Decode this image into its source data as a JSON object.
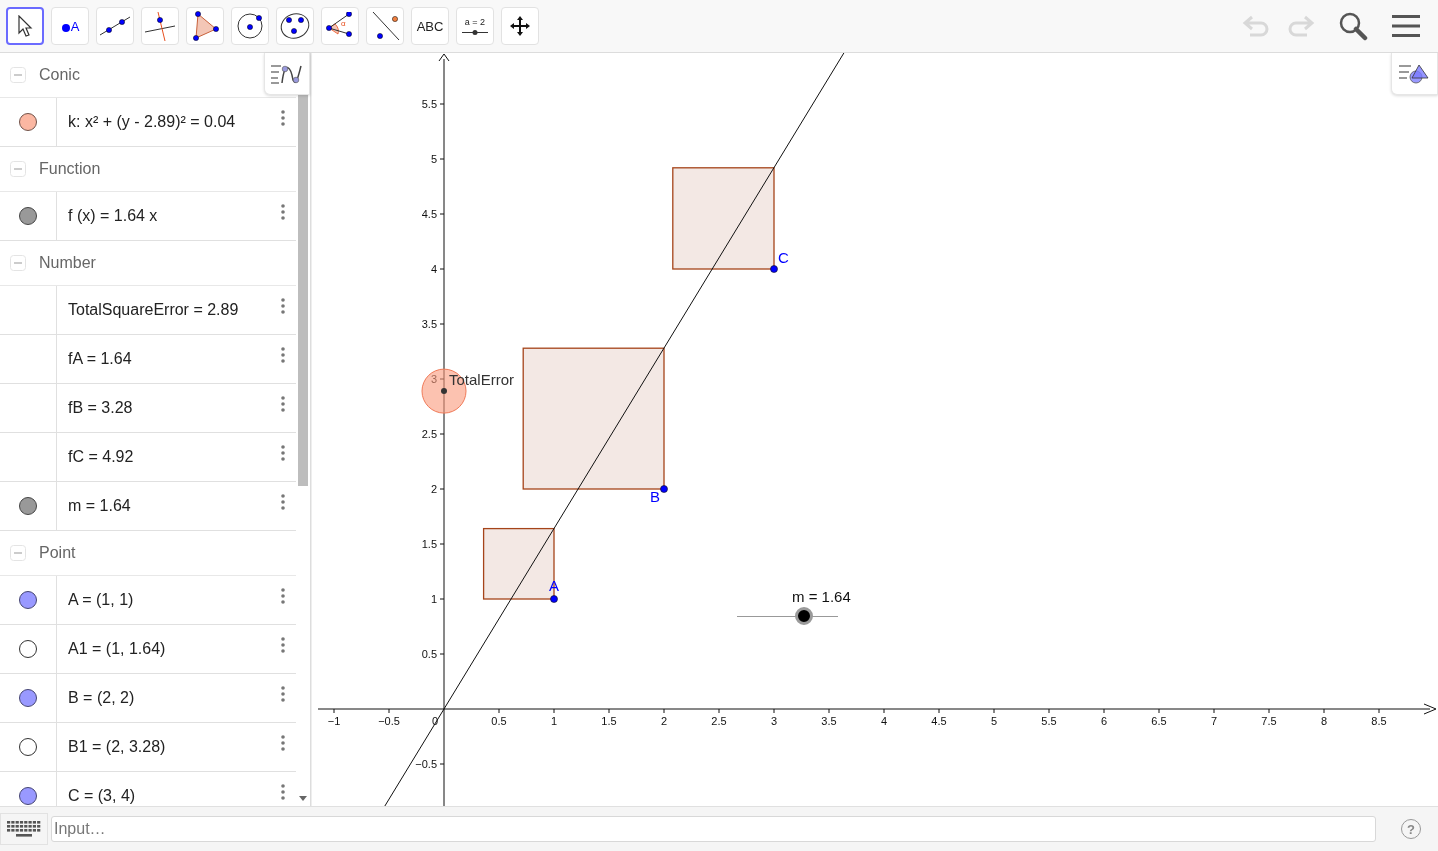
{
  "toolbar": {
    "tools": [
      {
        "kind": "move",
        "selected": true
      },
      {
        "kind": "point",
        "selected": false,
        "label": "A"
      },
      {
        "kind": "line",
        "selected": false
      },
      {
        "kind": "perpendicular",
        "selected": false
      },
      {
        "kind": "polygon",
        "selected": false
      },
      {
        "kind": "circle",
        "selected": false
      },
      {
        "kind": "conic",
        "selected": false
      },
      {
        "kind": "angle",
        "selected": false,
        "label": "α"
      },
      {
        "kind": "reflect",
        "selected": false
      },
      {
        "kind": "text",
        "selected": false,
        "label": "ABC"
      },
      {
        "kind": "slider",
        "selected": false,
        "label": "a = 2"
      },
      {
        "kind": "move_view",
        "selected": false
      }
    ],
    "undo": {
      "disabled": true
    },
    "redo": {
      "disabled": true
    }
  },
  "algebra": {
    "groups": [
      {
        "title": "Conic",
        "expanded": true,
        "items": [
          {
            "kind": "object",
            "visible": true,
            "color": "#fbb7a2",
            "text": "k: x² + (y - 2.89)² = 0.04"
          }
        ]
      },
      {
        "title": "Function",
        "expanded": true,
        "items": [
          {
            "kind": "object",
            "visible": true,
            "color": "#999999",
            "text": "f (x) = 1.64 x"
          }
        ]
      },
      {
        "title": "Number",
        "expanded": true,
        "items": [
          {
            "kind": "value",
            "text": "TotalSquareError = 2.89"
          },
          {
            "kind": "value",
            "text": "fA = 1.64"
          },
          {
            "kind": "value",
            "text": "fB = 3.28"
          },
          {
            "kind": "value",
            "text": "fC = 4.92"
          },
          {
            "kind": "object",
            "visible": true,
            "color": "#999999",
            "text": "m = 1.64"
          }
        ]
      },
      {
        "title": "Point",
        "expanded": true,
        "items": [
          {
            "kind": "object",
            "visible": true,
            "color": "#9999ff",
            "text": "A = (1, 1)"
          },
          {
            "kind": "object",
            "visible": false,
            "text": "A1 = (1, 1.64)"
          },
          {
            "kind": "object",
            "visible": true,
            "color": "#9999ff",
            "text": "B = (2, 2)"
          },
          {
            "kind": "object",
            "visible": false,
            "text": "B1 = (2, 3.28)"
          },
          {
            "kind": "object",
            "visible": true,
            "color": "#9999ff",
            "text": "C = (3, 4)"
          }
        ]
      }
    ]
  },
  "graphics": {
    "x_ticks": [
      "−1",
      "−0.5",
      "0",
      "0.5",
      "1",
      "1.5",
      "2",
      "2.5",
      "3",
      "3.5",
      "4",
      "4.5",
      "5",
      "5.5",
      "6",
      "6.5",
      "7",
      "7.5",
      "8",
      "8.5"
    ],
    "y_ticks": [
      "5.5",
      "5",
      "4.5",
      "4",
      "3.5",
      "3",
      "2.5",
      "2",
      "1.5",
      "1",
      "0.5",
      "−0.5"
    ],
    "points": [
      {
        "label": "A"
      },
      {
        "label": "B"
      },
      {
        "label": "C"
      }
    ],
    "error_label": "TotalError",
    "slider": {
      "caption": "m = 1.64",
      "level": 0.66
    }
  },
  "input_bar": {
    "placeholder": "Input…",
    "help": "?"
  }
}
